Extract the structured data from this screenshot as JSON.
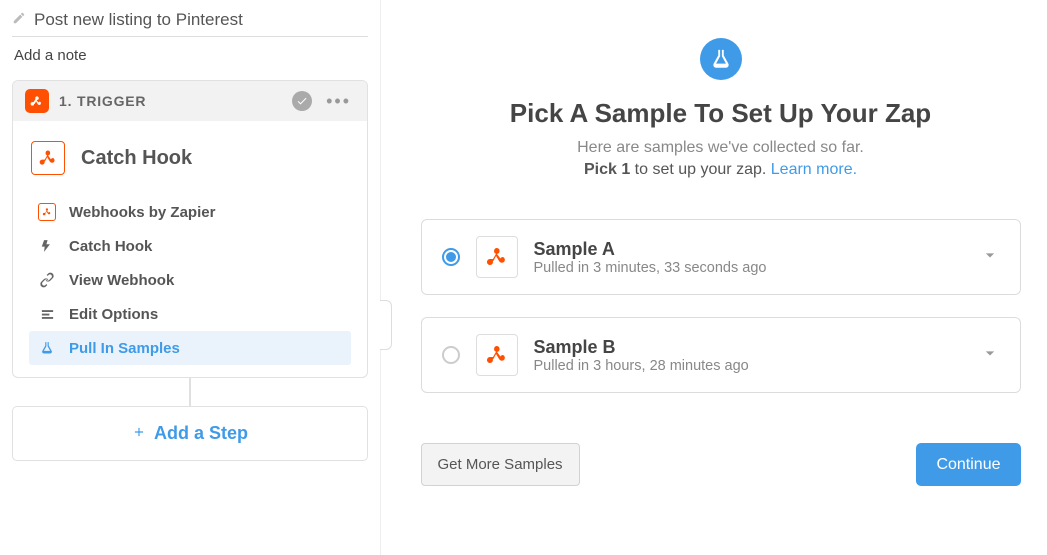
{
  "zap": {
    "title": "Post new listing to Pinterest",
    "add_note_label": "Add a note"
  },
  "trigger_step": {
    "header_label": "1. TRIGGER",
    "title": "Catch Hook",
    "substeps": {
      "app": "Webhooks by Zapier",
      "action": "Catch Hook",
      "view": "View Webhook",
      "edit": "Edit Options",
      "samples": "Pull In Samples"
    }
  },
  "add_step_label": "Add a Step",
  "main": {
    "heading": "Pick A Sample To Set Up Your Zap",
    "sub1": "Here are samples we've collected so far.",
    "pick_prefix": "Pick 1",
    "pick_rest": " to set up your zap. ",
    "learn_more": "Learn more."
  },
  "samples": [
    {
      "name": "Sample A",
      "time": "Pulled in 3 minutes, 33 seconds ago",
      "selected": true
    },
    {
      "name": "Sample B",
      "time": "Pulled in 3 hours, 28 minutes ago",
      "selected": false
    }
  ],
  "buttons": {
    "get_more": "Get More Samples",
    "continue": "Continue"
  }
}
